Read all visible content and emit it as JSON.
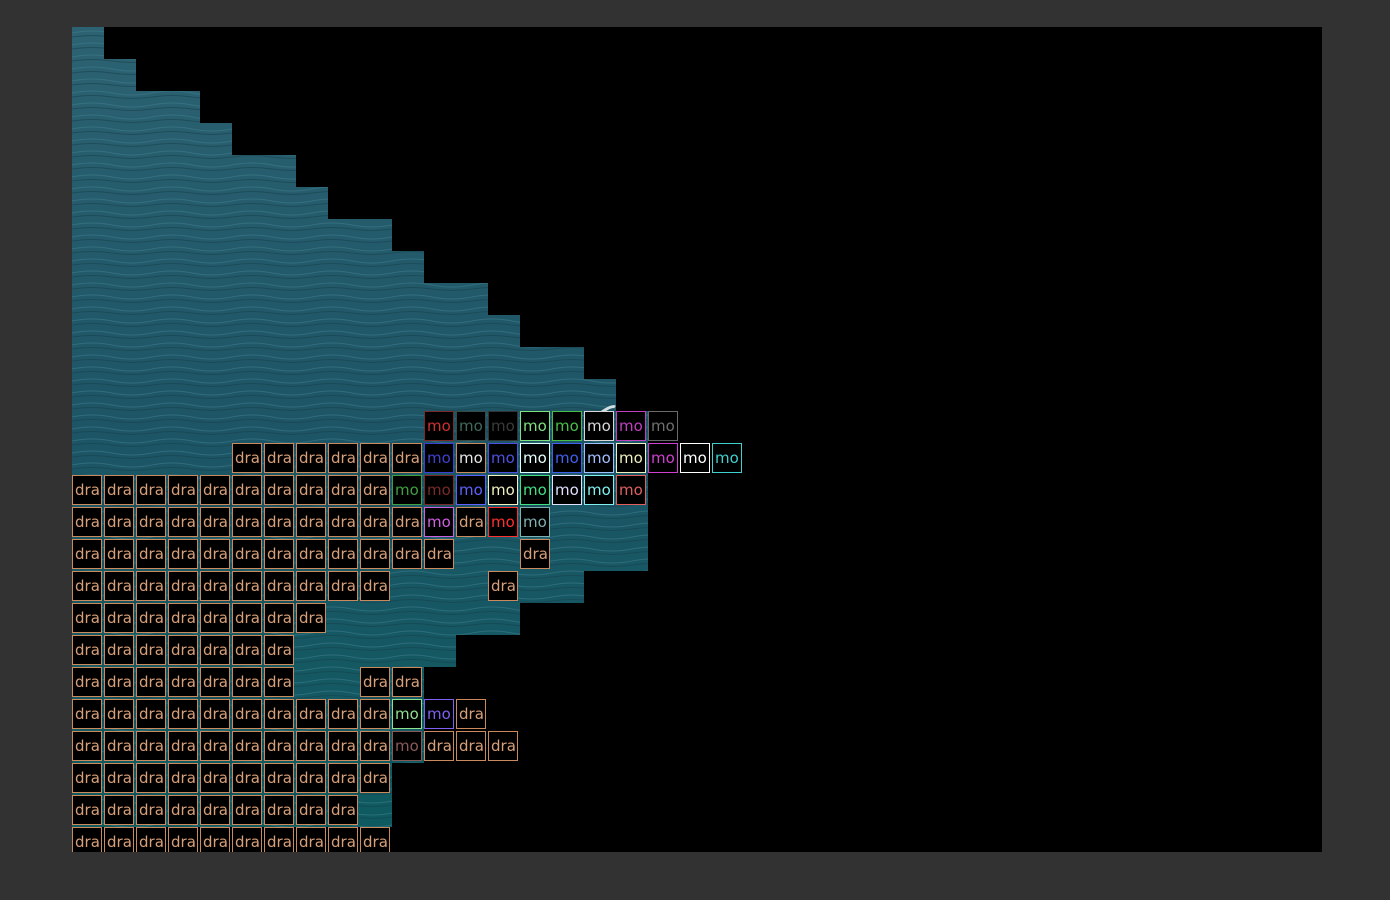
{
  "labels": {
    "dra": "dra",
    "mo": "mo"
  },
  "colors": {
    "page_bg": "#323232",
    "canvas_bg": "#000000",
    "dra_border": "#c98a5e",
    "dra_text": "#d9a07a",
    "water_dark": "#0f3a45",
    "water_light": "#2a6b7a"
  },
  "mo_tiles": [
    {
      "color": "#d03030",
      "border": "#7a2a2a"
    },
    {
      "color": "#3f6b5a",
      "border": "#3a4a44"
    },
    {
      "color": "#3b3b3b",
      "border": "#333333"
    },
    {
      "color": "#7fe07f",
      "border": "#7fe07f"
    },
    {
      "color": "#48c048",
      "border": "#48c048"
    },
    {
      "color": "#d8d8d8",
      "border": "#d8d8d8"
    },
    {
      "color": "#c040c0",
      "border": "#c040c0"
    },
    {
      "color": "#707070",
      "border": "#6a6a6a"
    },
    {
      "color": "#4040d0",
      "border": "#4040d0"
    },
    {
      "color": "#e8e8e8",
      "border": "#c98a5e"
    },
    {
      "color": "#5050e0",
      "border": "#5050e0"
    },
    {
      "color": "#e8ffff",
      "border": "#e0ffff"
    },
    {
      "color": "#4060f0",
      "border": "#4060f0"
    },
    {
      "color": "#a0c0ff",
      "border": "#a0c0ff"
    },
    {
      "color": "#f0f0c0",
      "border": "#f0f0c0"
    },
    {
      "color": "#d040d0",
      "border": "#d040d0"
    },
    {
      "color": "#ffffff",
      "border": "#ffffff"
    },
    {
      "color": "#40d0d0",
      "border": "#40d0d0"
    },
    {
      "color": "#40a040",
      "border": "#40a040"
    },
    {
      "color": "#7a2a2a",
      "border": "#7a2a2a"
    },
    {
      "color": "#6060ff",
      "border": "#6060ff"
    },
    {
      "color": "#f0f0c0",
      "border": "#f0f0c0"
    },
    {
      "color": "#40e080",
      "border": "#40e080"
    },
    {
      "color": "#e0e0ff",
      "border": "#e0e0ff"
    },
    {
      "color": "#80f0f0",
      "border": "#80f0f0"
    },
    {
      "color": "#e06060",
      "border": "#e06060"
    },
    {
      "color": "#d060e0",
      "border": "#d060e0"
    },
    {
      "color": "#ff3030",
      "border": "#ff3030"
    },
    {
      "color": "#80b0b0",
      "border": "#80b0b0"
    },
    {
      "color": "#90e090",
      "border": "#90e090"
    },
    {
      "color": "#8060f0",
      "border": "#8060f0"
    },
    {
      "color": "#8a5a5a",
      "border": "#8a5a5a"
    }
  ]
}
